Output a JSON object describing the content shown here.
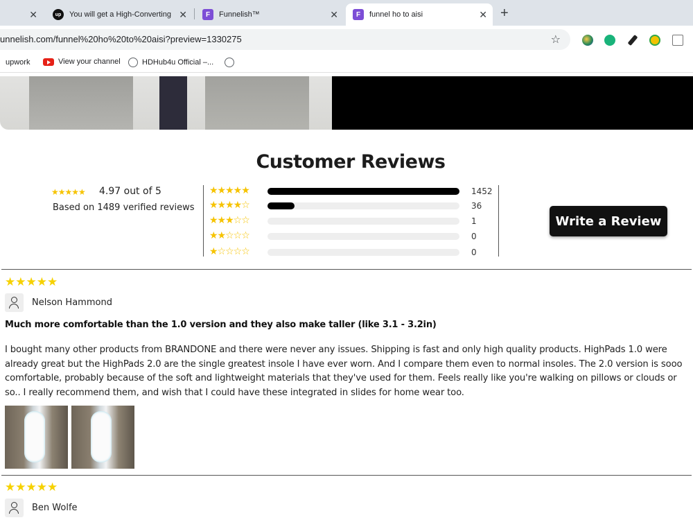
{
  "browser": {
    "tabs": [
      {
        "title": "You will get a High-Converting",
        "favicon": "up"
      },
      {
        "title": "Funnelish™",
        "favicon": "F"
      },
      {
        "title": "funnel ho to aisi",
        "favicon": "F",
        "active": true
      }
    ],
    "url": "unnelish.com/funnel%20ho%20to%20aisi?preview=1330275",
    "bookmarks": [
      "upwork",
      "View your channel",
      "HDHub4u Official –..."
    ],
    "new_tab": "+",
    "close_glyph": "✕",
    "star_glyph": "☆",
    "extension_icons": [
      "earth-extension-icon",
      "refresh-extension-icon",
      "eyedropper-extension-icon",
      "bulb-extension-icon",
      "text-extension-icon"
    ]
  },
  "reviews": {
    "heading": "Customer Reviews",
    "summary": {
      "stars": "★★★★★",
      "score": "4.97 out of 5",
      "based_on": "Based on 1489 verified reviews"
    },
    "histogram": [
      {
        "stars": "★★★★★",
        "count": "1452",
        "fraction": 1.0
      },
      {
        "stars": "★★★★☆",
        "count": "36",
        "fraction": 0.14
      },
      {
        "stars": "★★★☆☆",
        "count": "1",
        "fraction": 0.0
      },
      {
        "stars": "★★☆☆☆",
        "count": "0",
        "fraction": 0.0
      },
      {
        "stars": "★☆☆☆☆",
        "count": "0",
        "fraction": 0.0
      }
    ],
    "write_button": "Write a Review",
    "items": [
      {
        "stars": "★★★★★",
        "name": "Nelson Hammond",
        "title": "Much more comfortable than the 1.0 version and they also make taller (like 3.1 - 3.2in)",
        "body": "I bought many other products from BRANDONE and there were never any issues. Shipping is fast and only high quality products. HighPads 1.0 were already great but the HighPads 2.0 are the single greatest insole I have ever worn. And I compare them even to normal insoles. The 2.0 version is sooo comfortable, probably because of the soft and lightweight materials that they've used for them. Feels really like you're walking on pillows or clouds or so.. I really recommend them, and wish that I could have these integrated in slides for home wear too."
      },
      {
        "stars": "★★★★★",
        "name": "Ben Wolfe"
      }
    ]
  },
  "colors": {
    "star_yellow": "#f6d100",
    "button_bg": "#111111",
    "bar_fill": "#000000",
    "tab_strip": "#dee3e9",
    "funnelish_purple": "#7c4dd6"
  }
}
